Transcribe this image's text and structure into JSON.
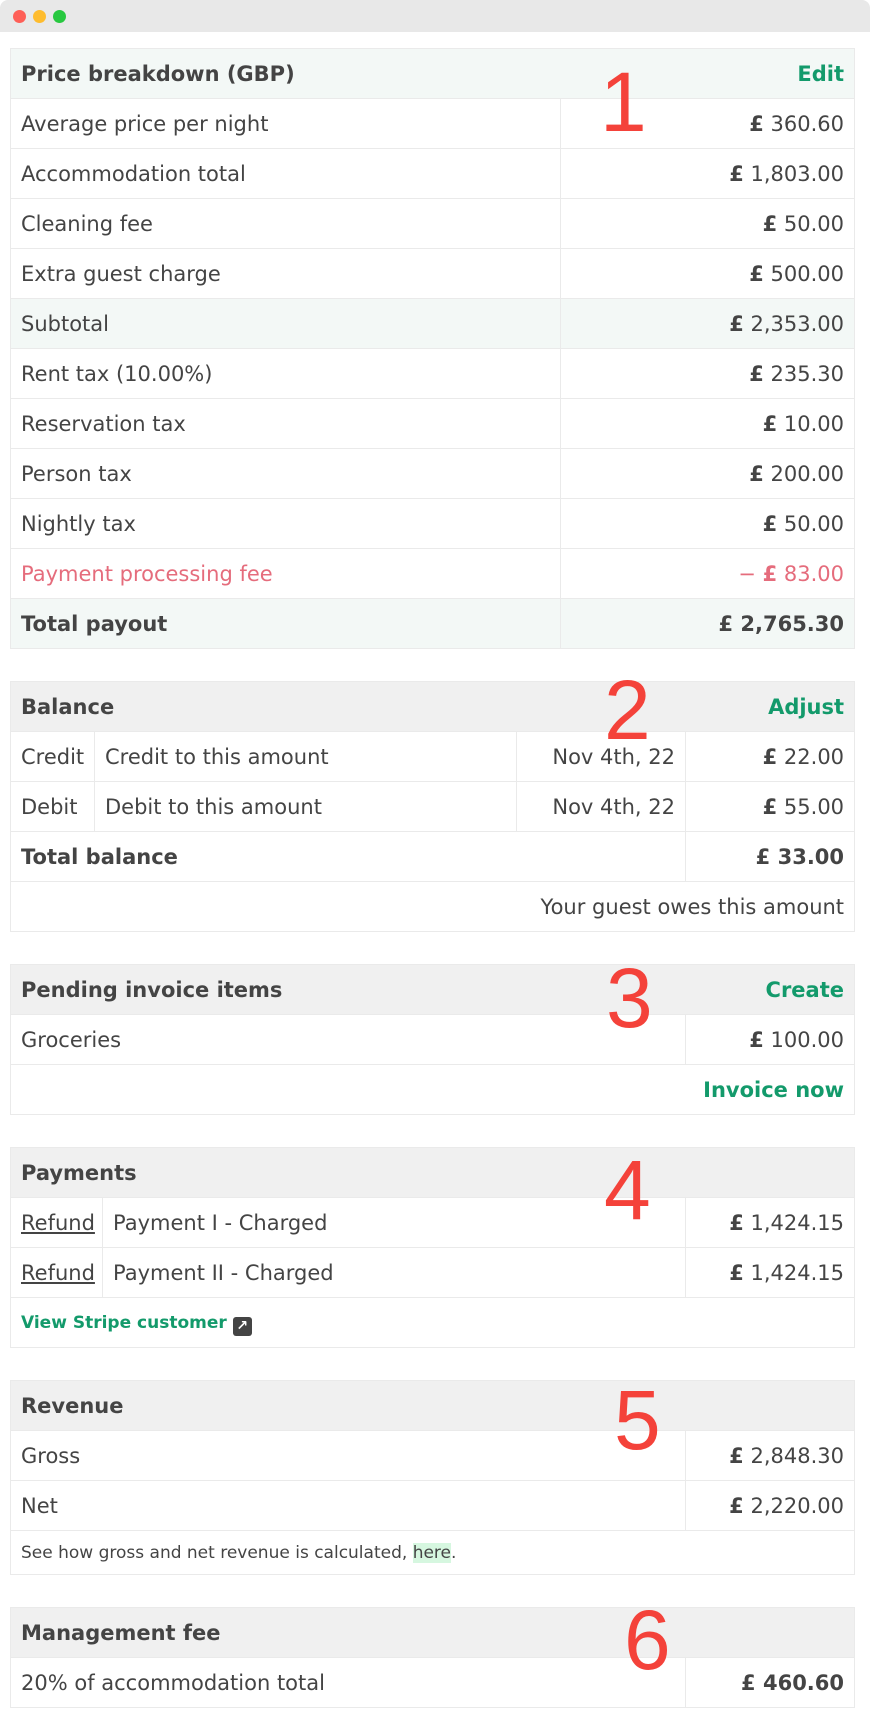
{
  "window": {
    "controls": [
      "close",
      "minimize",
      "maximize"
    ]
  },
  "annotations": [
    "1",
    "2",
    "3",
    "4",
    "5",
    "6"
  ],
  "currency_symbol": "£",
  "price_breakdown": {
    "title": "Price breakdown (GBP)",
    "action": "Edit",
    "rows": [
      {
        "label": "Average price per night",
        "amount": "360.60"
      },
      {
        "label": "Accommodation total",
        "amount": "1,803.00"
      },
      {
        "label": "Cleaning fee",
        "amount": "50.00"
      },
      {
        "label": "Extra guest charge",
        "amount": "500.00"
      },
      {
        "label": "Subtotal",
        "amount": "2,353.00"
      },
      {
        "label": "Rent tax (10.00%)",
        "amount": "235.30"
      },
      {
        "label": "Reservation tax",
        "amount": "10.00"
      },
      {
        "label": "Person tax",
        "amount": "200.00"
      },
      {
        "label": "Nightly tax",
        "amount": "50.00"
      },
      {
        "label": "Payment processing fee",
        "amount": "83.00",
        "sign": "−"
      },
      {
        "label": "Total payout",
        "amount": "2,765.30"
      }
    ]
  },
  "balance": {
    "title": "Balance",
    "action": "Adjust",
    "rows": [
      {
        "type": "Credit",
        "description": "Credit to this amount",
        "date": "Nov 4th, 22",
        "amount": "22.00"
      },
      {
        "type": "Debit",
        "description": "Debit to this amount",
        "date": "Nov 4th, 22",
        "amount": "55.00"
      }
    ],
    "total_label": "Total balance",
    "total_amount": "33.00",
    "note": "Your guest owes this amount"
  },
  "pending_invoice": {
    "title": "Pending invoice items",
    "action": "Create",
    "rows": [
      {
        "label": "Groceries",
        "amount": "100.00"
      }
    ],
    "invoice_now": "Invoice now"
  },
  "payments": {
    "title": "Payments",
    "rows": [
      {
        "refund": "Refund",
        "label": "Payment I - Charged",
        "amount": "1,424.15"
      },
      {
        "refund": "Refund",
        "label": "Payment II - Charged",
        "amount": "1,424.15"
      }
    ],
    "stripe_link": "View Stripe customer",
    "stripe_icon": "external-link-icon"
  },
  "revenue": {
    "title": "Revenue",
    "rows": [
      {
        "label": "Gross",
        "amount": "2,848.30"
      },
      {
        "label": "Net",
        "amount": "2,220.00"
      }
    ],
    "note_prefix": "See how gross and net revenue is calculated, ",
    "note_link": "here",
    "note_suffix": "."
  },
  "management_fee": {
    "title": "Management fee",
    "row": {
      "label": "20% of accommodation total",
      "amount": "460.60"
    }
  },
  "colors": {
    "accent_green": "#139a6b",
    "negative_pink": "#e56c7c",
    "annotation_red": "#f4423a",
    "header_grey": "#f0f0f0",
    "header_mint": "#f3f8f6"
  }
}
